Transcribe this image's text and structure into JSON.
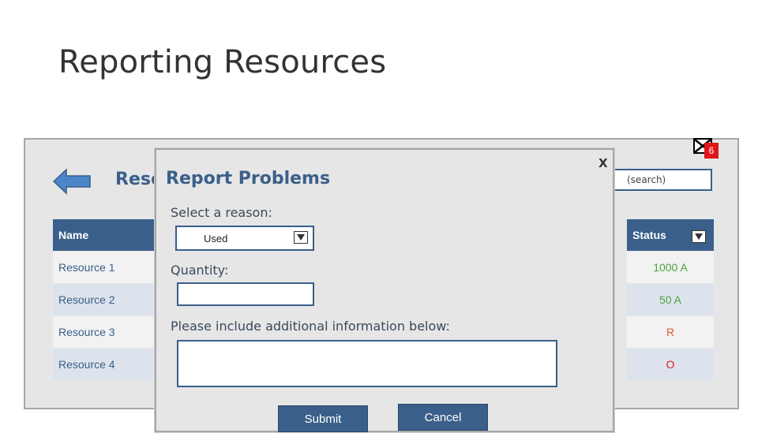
{
  "slide": {
    "title": "Reporting Resources"
  },
  "background": {
    "heading": "Reso",
    "search_placeholder": "(search)",
    "badge_count": "6",
    "table": {
      "name_header": "Name",
      "status_header": "Status",
      "rows": [
        {
          "name": "Resource 1",
          "status": "1000 A",
          "status_color": "#4aa33a"
        },
        {
          "name": "Resource 2",
          "status": "50 A",
          "status_color": "#4aa33a"
        },
        {
          "name": "Resource 3",
          "status": "R",
          "status_color": "#e05a2a"
        },
        {
          "name": "Resource 4",
          "status": "O",
          "status_color": "#e0161b"
        }
      ]
    }
  },
  "modal": {
    "close_label": "X",
    "title": "Report Problems",
    "reason_label": "Select a reason:",
    "reason_value": "Used",
    "quantity_label": "Quantity:",
    "quantity_value": "",
    "info_label": "Please include additional information below:",
    "info_value": "",
    "submit_label": "Submit",
    "cancel_label": "Cancel"
  },
  "colors": {
    "accent": "#3a5f8a",
    "frame": "#e6e6e6",
    "arrow": "#4a86c8"
  }
}
